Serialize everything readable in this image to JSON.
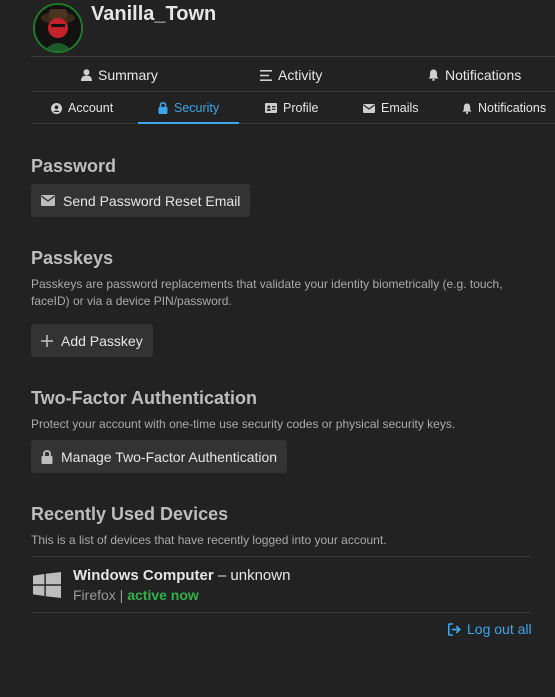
{
  "profile": {
    "username": "Vanilla_Town"
  },
  "nav_primary": [
    {
      "label": "Summary",
      "icon": "user-icon"
    },
    {
      "label": "Activity",
      "icon": "list-icon"
    },
    {
      "label": "Notifications",
      "icon": "bell-icon"
    }
  ],
  "nav_secondary": [
    {
      "label": "Account",
      "icon": "user-circle-icon"
    },
    {
      "label": "Security",
      "icon": "lock-icon",
      "active": true
    },
    {
      "label": "Profile",
      "icon": "id-card-icon"
    },
    {
      "label": "Emails",
      "icon": "envelope-icon"
    },
    {
      "label": "Notifications",
      "icon": "bell-icon"
    }
  ],
  "password": {
    "heading": "Password",
    "reset_button": "Send Password Reset Email"
  },
  "passkeys": {
    "heading": "Passkeys",
    "description": "Passkeys are password replacements that validate your identity biometrically (e.g. touch, faceID) or via a device PIN/password.",
    "add_button": "Add Passkey"
  },
  "two_factor": {
    "heading": "Two-Factor Authentication",
    "description": "Protect your account with one-time use security codes or physical security keys.",
    "manage_button": "Manage Two-Factor Authentication"
  },
  "devices": {
    "heading": "Recently Used Devices",
    "description": "This is a list of devices that have recently logged into your account.",
    "items": [
      {
        "name": "Windows Computer",
        "separator": " – ",
        "location": "unknown",
        "browser": "Firefox",
        "divider": " | ",
        "status": "active now",
        "icon": "windows-icon"
      }
    ],
    "logout_all": "Log out all"
  },
  "colors": {
    "accent": "#3ea6e8",
    "status_active": "#33b14a",
    "background": "#222222"
  }
}
